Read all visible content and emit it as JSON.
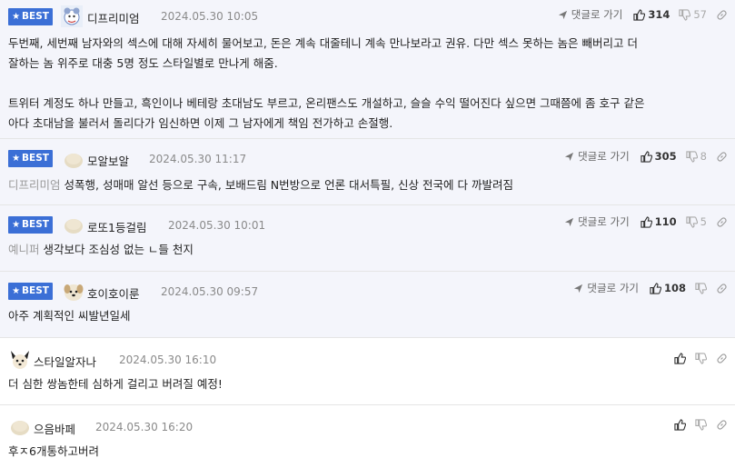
{
  "best_label": "BEST",
  "reply_label": "댓글로 가기",
  "comments": [
    {
      "best": true,
      "nick": "디프리미엄",
      "date": "2024.05.30 10:05",
      "up": "314",
      "down": "57",
      "lines": [
        "두번째, 세번째 남자와의 섹스에 대해 자세히 물어보고, 돈은 계속 대줄테니 계속 만나보라고 권유. 다만 섹스 못하는 놈은 빼버리고 더",
        "잘하는 놈 위주로 대충 5명 정도 스타일별로 만나게 해줌.",
        "",
        "트위터 계정도 하나 만들고, 흑인이나 베테랑 초대남도 부르고, 온리팬스도 개설하고, 슬슬 수익 떨어진다 싶으면 그때쯤에 좀 호구 같은",
        "아다 초대남을 불러서 돌리다가 임신하면 이제 그 남자에게 책임 전가하고 손절행."
      ]
    },
    {
      "best": true,
      "nick": "모알보알",
      "date": "2024.05.30 11:17",
      "up": "305",
      "down": "8",
      "mention": "디프리미엄",
      "lines": [
        "성폭행, 성매매 알선 등으로 구속, 보배드림 N번방으로 언론 대서특필, 신상 전국에 다 까발려짐"
      ]
    },
    {
      "best": true,
      "nick": "로또1등걸림",
      "date": "2024.05.30 10:01",
      "up": "110",
      "down": "5",
      "mention": "예니퍼",
      "lines": [
        "생각보다 조심성 없는 ㄴ들 천지"
      ]
    },
    {
      "best": true,
      "nick": "호이호이룬",
      "date": "2024.05.30 09:57",
      "up": "108",
      "down": "",
      "lines": [
        "아주 계획적인 씨발년일세"
      ]
    },
    {
      "best": false,
      "nick": "스타일알자나",
      "date": "2024.05.30 16:10",
      "lines": [
        "더 심한 쌍놈한테 심하게 걸리고 버려질 예정!"
      ]
    },
    {
      "best": false,
      "nick": "으음바페",
      "date": "2024.05.30 16:20",
      "lines": [
        "후ㅈ6개통하고버려"
      ]
    }
  ]
}
